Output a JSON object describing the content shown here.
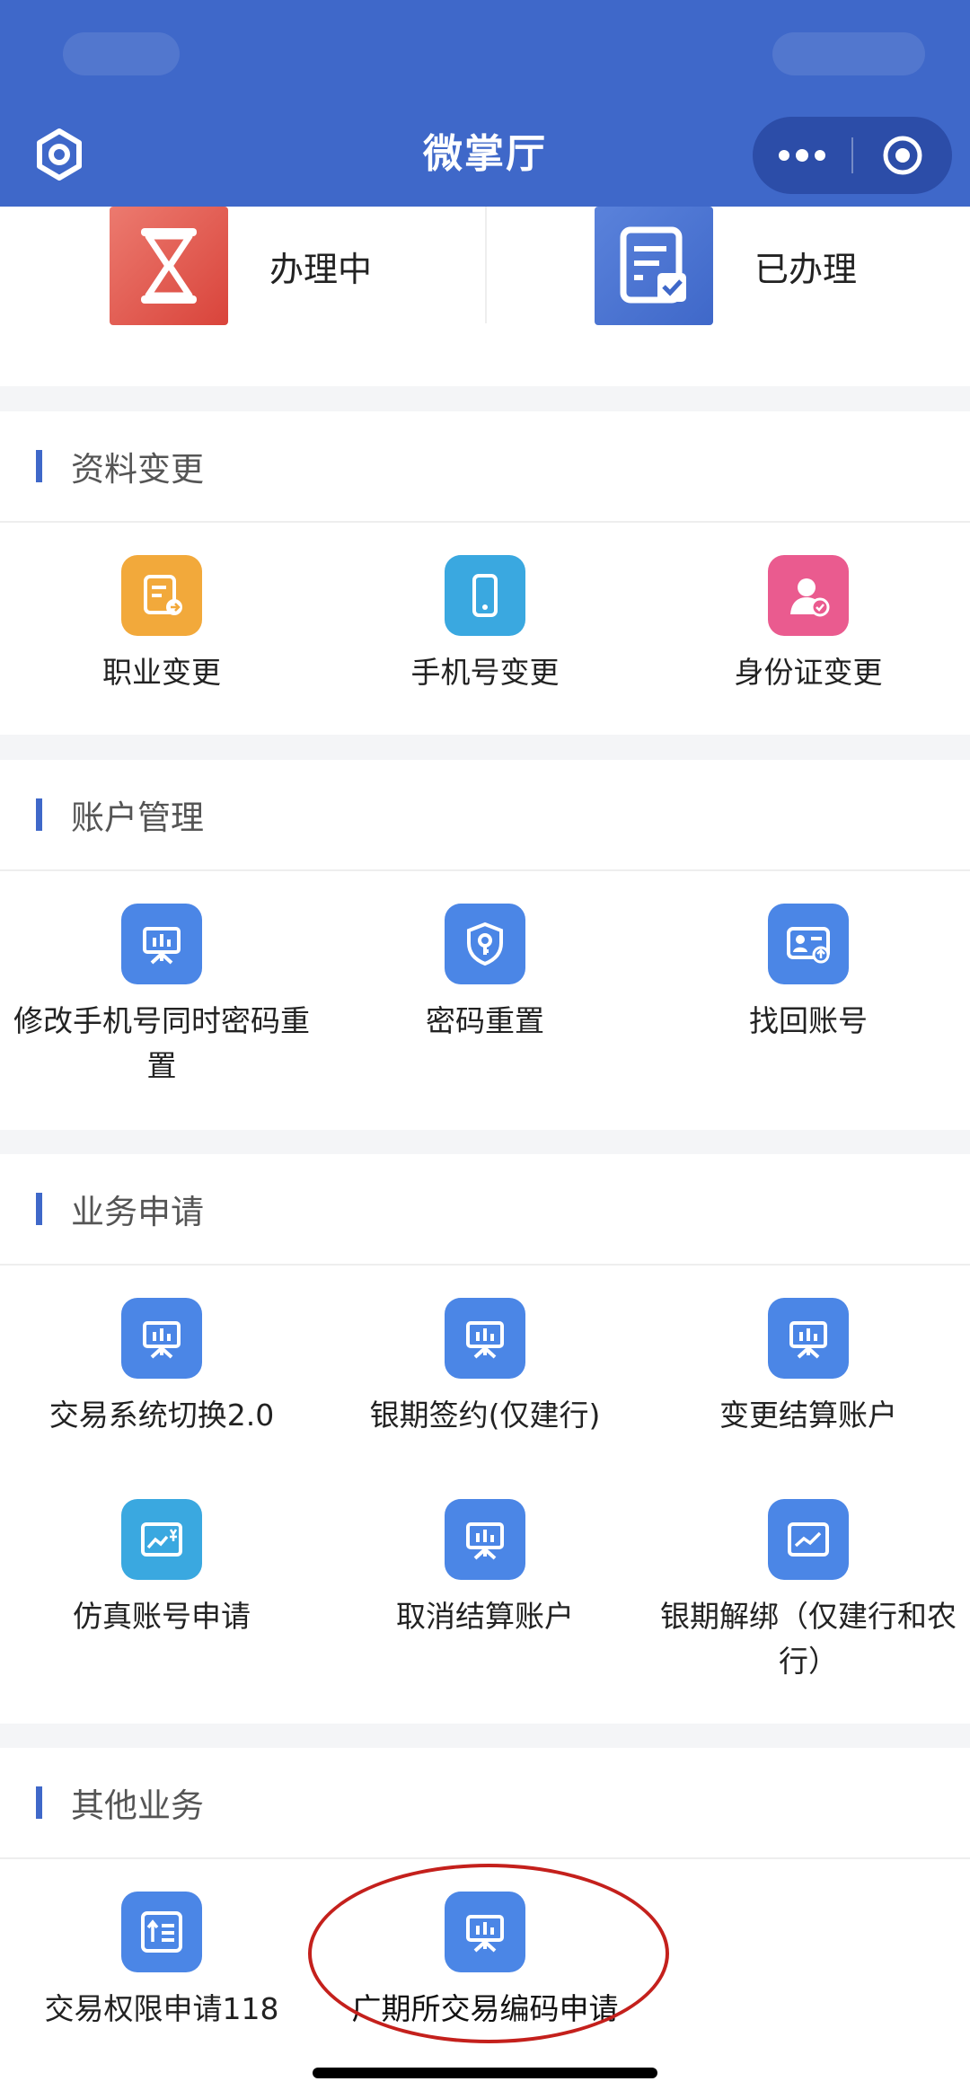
{
  "nav": {
    "title": "微掌厅",
    "left_icon": "settings-ring-icon",
    "more_icon": "more-dots-icon",
    "close_icon": "target-circle-icon"
  },
  "status": [
    {
      "label": "办理中",
      "icon": "hourglass-icon",
      "color": "#e0564e"
    },
    {
      "label": "已办理",
      "icon": "document-check-icon",
      "color": "#3f68c9"
    }
  ],
  "sections": [
    {
      "title": "资料变更",
      "items": [
        {
          "label": "职业变更",
          "icon": "form-arrow-icon",
          "color": "#f2a93b"
        },
        {
          "label": "手机号变更",
          "icon": "phone-icon",
          "color": "#3aa8e0"
        },
        {
          "label": "身份证变更",
          "icon": "user-check-icon",
          "color": "#ea5b8f"
        }
      ]
    },
    {
      "title": "账户管理",
      "items": [
        {
          "label": "修改手机号同时密码重置",
          "icon": "presentation-icon",
          "color": "#4b86e6"
        },
        {
          "label": "密码重置",
          "icon": "shield-key-icon",
          "color": "#4b86e6"
        },
        {
          "label": "找回账号",
          "icon": "id-card-icon",
          "color": "#4b86e6"
        }
      ]
    },
    {
      "title": "业务申请",
      "items": [
        {
          "label": "交易系统切换2.0",
          "icon": "presentation-icon",
          "color": "#4b86e6"
        },
        {
          "label": "银期签约(仅建行)",
          "icon": "presentation-icon",
          "color": "#4b86e6"
        },
        {
          "label": "变更结算账户",
          "icon": "presentation-icon",
          "color": "#4b86e6"
        },
        {
          "label": "仿真账号申请",
          "icon": "chart-yen-icon",
          "color": "#3aa8e0"
        },
        {
          "label": "取消结算账户",
          "icon": "presentation-icon",
          "color": "#4b86e6"
        },
        {
          "label": "银期解绑（仅建行和农行）",
          "icon": "trend-chart-icon",
          "color": "#4b86e6"
        }
      ]
    },
    {
      "title": "其他业务",
      "items": [
        {
          "label": "交易权限申请118",
          "icon": "sort-list-icon",
          "color": "#4b86e6"
        },
        {
          "label": "广期所交易编码申请",
          "icon": "presentation-icon",
          "color": "#4b86e6"
        }
      ]
    }
  ]
}
